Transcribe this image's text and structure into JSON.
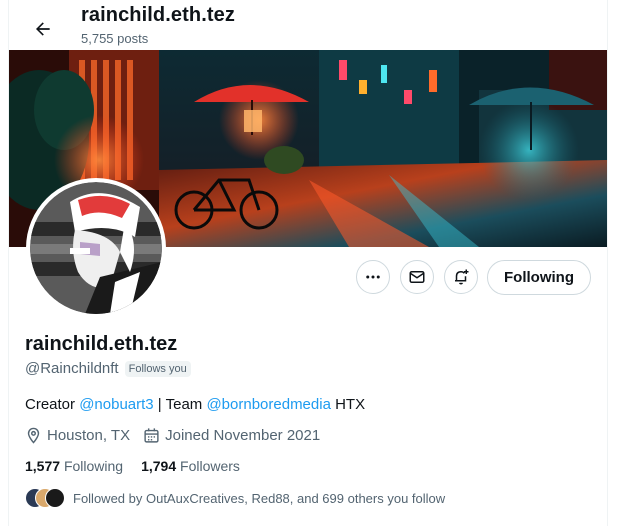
{
  "header": {
    "title": "rainchild.eth.tez",
    "post_count": "5,755 posts"
  },
  "actions": {
    "following_label": "Following"
  },
  "profile": {
    "display_name": "rainchild.eth.tez",
    "handle": "@Rainchildnft",
    "follows_you_badge": "Follows you",
    "bio": {
      "prefix": "Creator ",
      "mention1": "@nobuart3",
      "middle": " | Team ",
      "mention2": "@bornboredmedia",
      "suffix": " HTX"
    },
    "location": "Houston, TX",
    "joined": "Joined November 2021",
    "following_count": "1,577",
    "following_label": "Following",
    "followers_count": "1,794",
    "followers_label": "Followers",
    "followed_by": "Followed by OutAuxCreatives, Red88, and 699 others you follow"
  },
  "colors": {
    "accent": "#1d9bf0",
    "text_secondary": "#536471",
    "border": "#cfd9de"
  },
  "icons": {
    "back": "arrow-left-icon",
    "more": "more-icon",
    "message": "envelope-icon",
    "notify": "bell-plus-icon",
    "location": "location-pin-icon",
    "calendar": "calendar-icon"
  }
}
